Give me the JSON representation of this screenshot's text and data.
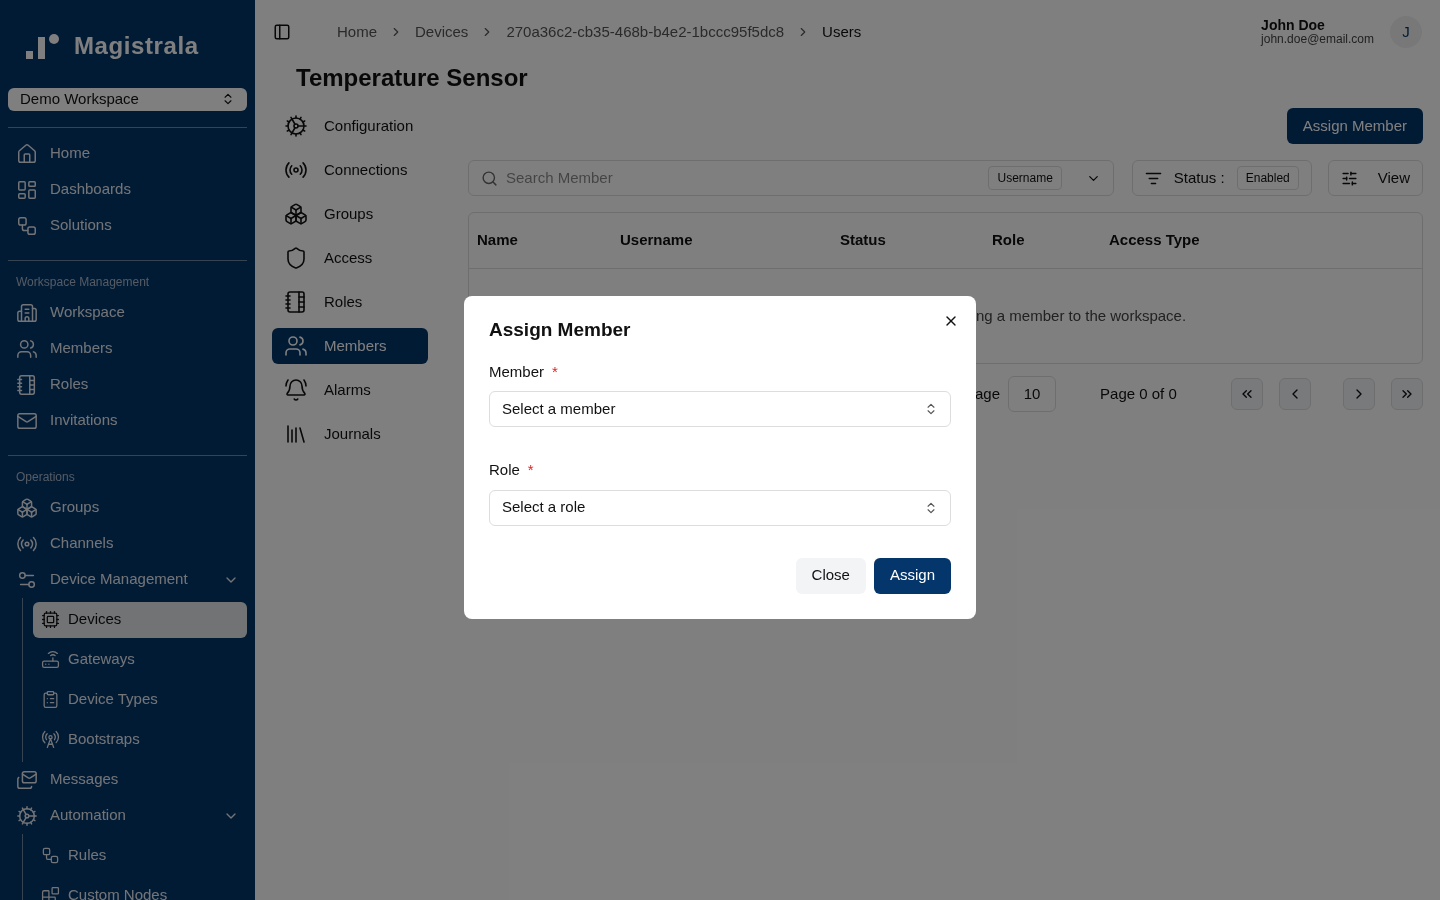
{
  "sidebar": {
    "logo": "Magistrala",
    "workspace": "Demo Workspace",
    "sections": [
      {
        "items": [
          {
            "label": "Home",
            "selected": false
          },
          {
            "label": "Dashboards",
            "selected": false
          },
          {
            "label": "Solutions",
            "selected": false
          }
        ]
      },
      {
        "label": "Workspace Management",
        "items": [
          {
            "label": "Workspace",
            "selected": false
          },
          {
            "label": "Members",
            "selected": false
          },
          {
            "label": "Roles",
            "selected": false
          },
          {
            "label": "Invitations",
            "selected": false
          }
        ]
      },
      {
        "label": "Operations",
        "items": [
          {
            "label": "Groups",
            "selected": false
          },
          {
            "label": "Channels",
            "selected": false
          },
          {
            "label": "Device Management",
            "selected": false,
            "expanded": true,
            "children": [
              {
                "label": "Devices",
                "selected": true
              },
              {
                "label": "Gateways",
                "selected": false
              },
              {
                "label": "Device Types",
                "selected": false
              },
              {
                "label": "Bootstraps",
                "selected": false
              }
            ]
          },
          {
            "label": "Messages",
            "selected": false
          },
          {
            "label": "Automation",
            "selected": false,
            "expanded": true,
            "children": [
              {
                "label": "Rules",
                "selected": false
              },
              {
                "label": "Custom Nodes",
                "selected": false
              }
            ]
          }
        ]
      }
    ]
  },
  "breadcrumbs": [
    "Home",
    "Devices",
    "270a36c2-cb35-468b-b4e2-1bccc95f5dc8",
    "Users"
  ],
  "user": {
    "name": "John Doe",
    "email": "john.doe@email.com",
    "initial": "J"
  },
  "title": "Temperature Sensor",
  "subnav": [
    {
      "label": "Configuration",
      "selected": false
    },
    {
      "label": "Connections",
      "selected": false
    },
    {
      "label": "Groups",
      "selected": false
    },
    {
      "label": "Access",
      "selected": false
    },
    {
      "label": "Roles",
      "selected": false
    },
    {
      "label": "Members",
      "selected": true
    },
    {
      "label": "Alarms",
      "selected": false
    },
    {
      "label": "Journals",
      "selected": false
    }
  ],
  "assign_button": "Assign Member",
  "toolbar": {
    "search": {
      "placeholder": "Search Member"
    },
    "search_by": "Username",
    "status_label": "Status :",
    "status_value": "Enabled",
    "view": "View"
  },
  "table": {
    "columns": [
      "Name",
      "Username",
      "Status",
      "Role",
      "Access Type"
    ],
    "empty_message": "ng a member to the workspace."
  },
  "pagination": {
    "rows_label": "age",
    "rows_value": "10",
    "page": "Page 0 of 0"
  },
  "dialog": {
    "title": "Assign Member",
    "fields": [
      {
        "label": "Member",
        "required_mark": "*",
        "placeholder": "Select a member"
      },
      {
        "label": "Role",
        "required_mark": "*",
        "placeholder": "Select a role"
      }
    ],
    "buttons": [
      {
        "label": "Close",
        "kind": "secondary"
      },
      {
        "label": "Assign",
        "kind": "primary"
      }
    ]
  }
}
